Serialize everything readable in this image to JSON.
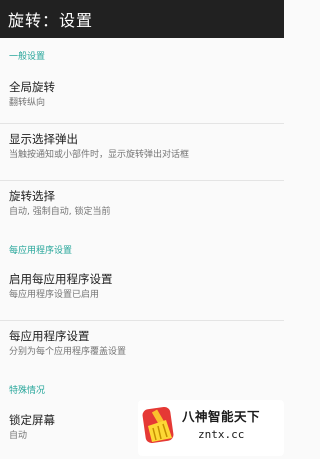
{
  "appbar": {
    "title": "旋转：设置"
  },
  "sections": [
    {
      "header": "一般设置",
      "items": [
        {
          "title": "全局旋转",
          "summary": "翻转纵向"
        },
        {
          "title": "显示选择弹出",
          "summary": "当触按通知或小部件时，显示旋转弹出对话框"
        },
        {
          "title": "旋转选择",
          "summary": "自动, 强制自动, 锁定当前"
        }
      ]
    },
    {
      "header": "每应用程序设置",
      "items": [
        {
          "title": "启用每应用程序设置",
          "summary": "每应用程序设置已启用"
        },
        {
          "title": "每应用程序设置",
          "summary": "分别为每个应用程序覆盖设置"
        }
      ]
    },
    {
      "header": "特殊情况",
      "items": [
        {
          "title": "锁定屏幕",
          "summary": "自动"
        }
      ]
    }
  ],
  "watermark": {
    "name": "八神智能天下",
    "url": "zntx.cc",
    "logo_icon": "broom-logo-icon"
  }
}
